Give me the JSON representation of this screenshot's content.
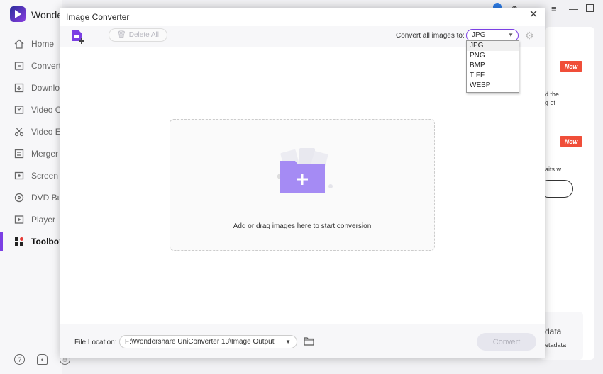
{
  "app": {
    "name": "Wonder",
    "nav": [
      {
        "label": "Home",
        "icon": "home-icon"
      },
      {
        "label": "Converter",
        "icon": "converter-icon"
      },
      {
        "label": "Downloader",
        "icon": "download-icon"
      },
      {
        "label": "Video Compressor",
        "icon": "compress-icon"
      },
      {
        "label": "Video Editor",
        "icon": "scissors-icon"
      },
      {
        "label": "Merger",
        "icon": "merge-icon"
      },
      {
        "label": "Screen Recorder",
        "icon": "record-icon"
      },
      {
        "label": "DVD Burner",
        "icon": "disc-icon"
      },
      {
        "label": "Player",
        "icon": "play-icon"
      },
      {
        "label": "Toolbox",
        "icon": "grid-icon"
      }
    ],
    "active_nav": "Toolbox",
    "badge_new": "New",
    "bg_texts": [
      "d the",
      "g of",
      "aits w...",
      "data",
      "etadata"
    ]
  },
  "dialog": {
    "title": "Image Converter",
    "delete_all": "Delete All",
    "convert_all_label": "Convert all images to:",
    "format_selected": "JPG",
    "format_options": [
      "JPG",
      "PNG",
      "BMP",
      "TIFF",
      "WEBP"
    ],
    "drop_hint": "Add or drag images here to start conversion",
    "file_location_label": "File Location:",
    "file_location_value": "F:\\Wondershare UniConverter 13\\Image Output",
    "convert_button": "Convert"
  },
  "colors": {
    "accent": "#7b3fe4",
    "badge": "#f04e39",
    "folder": "#a58bf4"
  }
}
